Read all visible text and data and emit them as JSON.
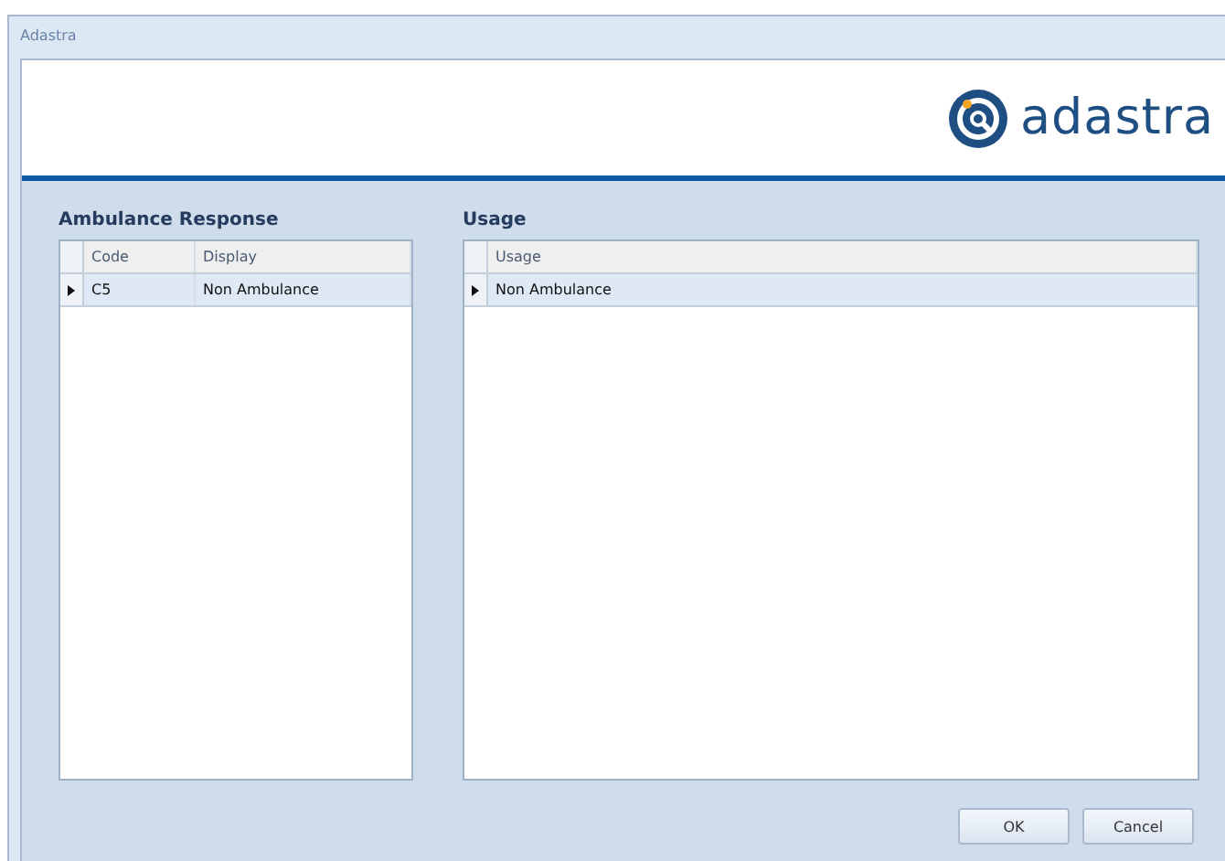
{
  "window": {
    "title": "Adastra"
  },
  "logo": {
    "text": "adastra"
  },
  "panels": [
    {
      "title": "Ambulance Response",
      "columns": [
        "Code",
        "Display"
      ],
      "rows": [
        {
          "cells": [
            "C5",
            "Non Ambulance"
          ],
          "selected": true
        }
      ]
    },
    {
      "title": "Usage",
      "columns": [
        "Usage"
      ],
      "rows": [
        {
          "cells": [
            "Non Ambulance"
          ],
          "selected": true
        }
      ]
    }
  ],
  "buttons": [
    "OK",
    "Cancel"
  ]
}
